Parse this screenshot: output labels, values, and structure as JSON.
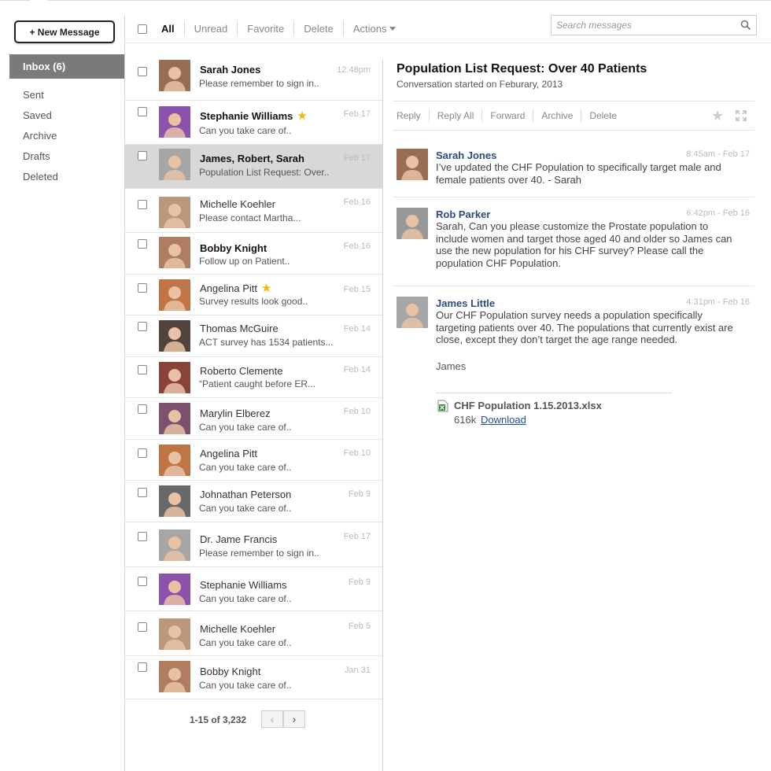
{
  "sidebar": {
    "new_message_label": "+ New Message",
    "inbox_label": "Inbox (6)",
    "folders": [
      "Sent",
      "Saved",
      "Archive",
      "Drafts",
      "Deleted"
    ]
  },
  "toolbar": {
    "filters": [
      "All",
      "Unread",
      "Favorite",
      "Delete",
      "Actions"
    ],
    "search_placeholder": "Search messages"
  },
  "messages": [
    {
      "name": "Sarah Jones",
      "snippet": "Please remember to sign in..",
      "date": "12:48pm",
      "bold": true,
      "starred": false,
      "avatar_color": "#8a5a3c"
    },
    {
      "name": "Stephanie Williams",
      "snippet": "Can you take care of..",
      "date": "Feb 17",
      "bold": true,
      "starred": true,
      "avatar_color": "#7c3ca0"
    },
    {
      "name": "James, Robert, Sarah",
      "snippet": "Population List Request: Over..",
      "date": "Feb 17",
      "bold": true,
      "starred": false,
      "avatar_color": "#9a9a9a"
    },
    {
      "name": "Michelle Koehler",
      "snippet": "Please contact Martha...",
      "date": "Feb 16",
      "bold": false,
      "starred": false,
      "avatar_color": "#b08a6a"
    },
    {
      "name": "Bobby Knight",
      "snippet": "Follow up on Patient..",
      "date": "Feb 16",
      "bold": true,
      "starred": false,
      "avatar_color": "#a56b4c"
    },
    {
      "name": "Angelina Pitt",
      "snippet": "Survey results look good..",
      "date": "Feb 15",
      "bold": false,
      "starred": true,
      "avatar_color": "#b8622e"
    },
    {
      "name": "Thomas McGuire",
      "snippet": "ACT survey has 1534 patients...",
      "date": "Feb 14",
      "bold": false,
      "starred": false,
      "avatar_color": "#3a2a20"
    },
    {
      "name": "Roberto Clemente",
      "snippet": "“Patient caught before ER...",
      "date": "Feb 14",
      "bold": false,
      "starred": false,
      "avatar_color": "#7a2a20"
    },
    {
      "name": "Marylin Elberez",
      "snippet": "Can you take care of..",
      "date": "Feb 10",
      "bold": false,
      "starred": false,
      "avatar_color": "#6a3a5a"
    },
    {
      "name": "Angelina Pitt",
      "snippet": "Can you take care of..",
      "date": "Feb 10",
      "bold": false,
      "starred": false,
      "avatar_color": "#b8622e"
    },
    {
      "name": "Johnathan Peterson",
      "snippet": "Can you take care of..",
      "date": "Feb 9",
      "bold": false,
      "starred": false,
      "avatar_color": "#555555"
    },
    {
      "name": "Dr. Jame Francis",
      "snippet": "Please remember to sign in..",
      "date": "Feb 17",
      "bold": false,
      "starred": false,
      "avatar_color": "#9a9a9a"
    },
    {
      "name": "Stephanie Williams",
      "snippet": "Can you take care of..",
      "date": "Feb 9",
      "bold": false,
      "starred": false,
      "avatar_color": "#7c3ca0"
    },
    {
      "name": "Michelle Koehler",
      "snippet": "Can you take care of..",
      "date": "Feb 5",
      "bold": false,
      "starred": false,
      "avatar_color": "#b08a6a"
    },
    {
      "name": "Bobby Knight",
      "snippet": "Can you take care of..",
      "date": "Jan 31",
      "bold": false,
      "starred": false,
      "avatar_color": "#a56b4c"
    }
  ],
  "pager": {
    "count": "1-15 of 3,232",
    "prev": "‹",
    "next": "›"
  },
  "conversation": {
    "subject": "Population List Request: Over 40 Patients",
    "started": "Conversation started on Feburary, 2013",
    "actions": [
      "Reply",
      "Reply All",
      "Forward",
      "Archive",
      "Delete"
    ],
    "messages": [
      {
        "sender": "Sarah Jones",
        "time": "8:45am - Feb 17",
        "body": "I’ve updated the CHF Population to specifically target male and female patients over 40.  - Sarah",
        "avatar_color": "#8a5a3c"
      },
      {
        "sender": "Rob Parker",
        "time": "6:42pm - Feb 16",
        "body": "Sarah, Can you please customize the Prostate population to include women and target those aged 40 and older so James can use the new population for his CHF survey?  Please call the population CHF Population.",
        "avatar_color": "#8a8a8a"
      },
      {
        "sender": "James Little",
        "time": "4:31pm - Feb 16",
        "body": "Our CHF Population survey needs a population specifically targeting patients over 40.  The populations that currently exist are close, except they don’t target the age range needed.",
        "avatar_color": "#9a9a9a"
      }
    ],
    "signoff": "James",
    "attachment": {
      "name": "CHF Population 1.15.2013.xlsx",
      "size": "616k",
      "download_label": "Download"
    }
  }
}
